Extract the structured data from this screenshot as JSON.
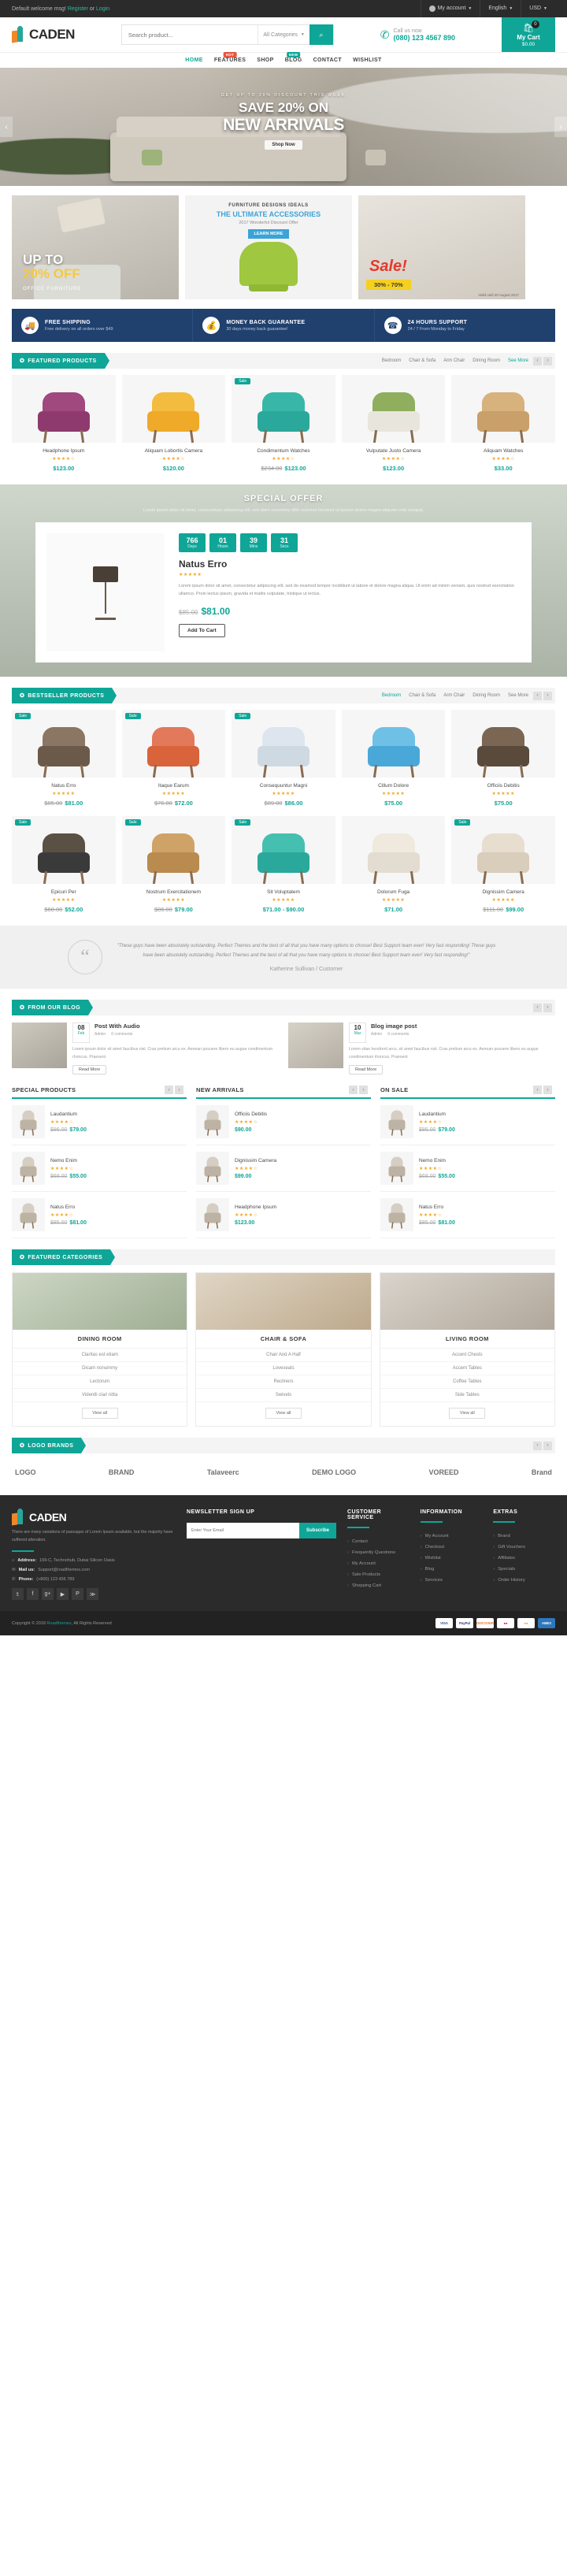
{
  "topbar": {
    "welcome": "Default welcome msg!",
    "register": "Register",
    "or": "or",
    "login": "Login",
    "account": "My account",
    "language": "English",
    "currency": "USD"
  },
  "header": {
    "brand": "CADEN",
    "search_placeholder": "Search product...",
    "category_label": "All Categories",
    "search_icon": "search-icon",
    "call_label": "Call us now",
    "phone": "(080) 123 4567 890",
    "cart_label": "My Cart",
    "cart_total": "$0.00",
    "cart_count": "0"
  },
  "nav": {
    "items": [
      {
        "label": "HOME",
        "active": true,
        "badge": ""
      },
      {
        "label": "FEATURES",
        "active": false,
        "badge": "HOT"
      },
      {
        "label": "SHOP",
        "active": false,
        "badge": ""
      },
      {
        "label": "BLOG",
        "active": false,
        "badge": "NEW"
      },
      {
        "label": "CONTACT",
        "active": false,
        "badge": ""
      },
      {
        "label": "WISHLIST",
        "active": false,
        "badge": ""
      }
    ]
  },
  "hero": {
    "kicker": "GET UP TO 20% DISCOUNT THIS WEEK",
    "line1": "SAVE 20% ON",
    "line2": "NEW ARRIVALS",
    "button": "Shop Now"
  },
  "promos": {
    "left": {
      "l1": "UP TO",
      "l2": "20% OFF",
      "l3": "OFFICE FURNITURE"
    },
    "center": {
      "kicker": "FURNITURE DESIGNS IDEALS",
      "title": "THE ULTIMATE ACCESSORIES",
      "sub": "2017 Wonderful Discount Offer",
      "button": "LEARN MORE"
    },
    "right": {
      "sale": "Sale!",
      "off": "30% - 70%",
      "note": "Valid until 20 August 2017"
    }
  },
  "services": [
    {
      "icon": "truck-icon",
      "title": "FREE SHIPPING",
      "sub": "Free delivery on all orders over $49"
    },
    {
      "icon": "money-icon",
      "title": "MONEY BACK GUARANTEE",
      "sub": "30 days money back guarantee!"
    },
    {
      "icon": "support-icon",
      "title": "24 HOURS SUPPORT",
      "sub": "24 / 7 From Monday to Friday"
    }
  ],
  "featured": {
    "section_title": "FEATURED PRODUCTS",
    "tabs": [
      "Bedroom",
      "Chair & Sofa",
      "Arm Chair",
      "Dining Room",
      "See More"
    ],
    "active_tab": "See More",
    "products": [
      {
        "name": "Headphone Ipsum",
        "price": "$123.00",
        "old": "",
        "stars": 4,
        "sale": false,
        "color": "#8e3a6e",
        "back": "#a0497e"
      },
      {
        "name": "Aliquam Lobortis Camera",
        "price": "$120.00",
        "old": "",
        "stars": 4,
        "sale": false,
        "color": "#efaa2a",
        "back": "#f3bc3e"
      },
      {
        "name": "Condimentum Watches",
        "price": "$123.00",
        "old": "$234.00",
        "stars": 4,
        "sale": true,
        "color": "#2aa89b",
        "back": "#38b7a8"
      },
      {
        "name": "Vulputate Justo Camera",
        "price": "$123.00",
        "old": "",
        "stars": 4,
        "sale": false,
        "color": "#e8e6dc",
        "back": "#8fae5e"
      },
      {
        "name": "Aliquam Watches",
        "price": "$33.00",
        "old": "",
        "stars": 4,
        "sale": false,
        "color": "#c9a06a",
        "back": "#d7b27d"
      }
    ]
  },
  "special": {
    "title": "SPECIAL OFFER",
    "subtitle": "Lorem ipsum dolor sit amet, consectetuer adipiscing elit, sed diam nonummy nibh euismod tincidunt ut laoreet dolore magna aliquam erat volutpat.",
    "countdown": [
      {
        "value": "766",
        "label": "Days"
      },
      {
        "value": "01",
        "label": "Hours"
      },
      {
        "value": "39",
        "label": "Mins"
      },
      {
        "value": "31",
        "label": "Secs"
      }
    ],
    "product_name": "Natus Erro",
    "stars": 5,
    "description": "Lorem ipsum dolor sit amet, consectetur adipiscing elit, sed do eiusmod tempor incididunt ut labore et dolore magna aliqua. Ut enim ad minim veniam, quis nostrud exercitation ullamco. Proin lectus ipsum, gravida et mattis vulputate, tristique ut lectus.",
    "price": "$81.00",
    "old_price": "$85.00",
    "button": "Add To Cart"
  },
  "bestseller": {
    "section_title": "BESTSELLER PRODUCTS",
    "tabs": [
      "Bedroom",
      "Chair & Sofa",
      "Arm Chair",
      "Dining Room",
      "See More"
    ],
    "active_tab": "Bedroom",
    "row1": [
      {
        "name": "Natus Erro",
        "price": "$81.00",
        "old": "$85.00",
        "stars": 5,
        "sale": true
      },
      {
        "name": "Itaque Earum",
        "price": "$72.00",
        "old": "$76.00",
        "stars": 5,
        "sale": true
      },
      {
        "name": "Consequuntur Magni",
        "price": "$86.00",
        "old": "$89.00",
        "stars": 5,
        "sale": true
      },
      {
        "name": "Cillum Dolore",
        "price": "$75.00",
        "old": "",
        "stars": 5,
        "sale": false
      },
      {
        "name": "Officiis Debitis",
        "price": "$75.00",
        "old": "",
        "stars": 5,
        "sale": false
      }
    ],
    "row2": [
      {
        "name": "Epicuri Per",
        "price": "$52.00",
        "old": "$68.00",
        "stars": 5,
        "sale": true
      },
      {
        "name": "Nostrum Exercitationem",
        "price": "$79.00",
        "old": "$86.00",
        "stars": 5,
        "sale": true
      },
      {
        "name": "Sit Voluptatem",
        "price": "$71.00 - $90.00",
        "old": "",
        "stars": 5,
        "sale": true
      },
      {
        "name": "Dolorum Fuga",
        "price": "$71.00",
        "old": "",
        "stars": 5,
        "sale": false
      },
      {
        "name": "Dignissim Camera",
        "price": "$99.00",
        "old": "$111.00",
        "stars": 5,
        "sale": true
      }
    ]
  },
  "testimonial": {
    "text": "\"These guys have been absolutely outstanding. Perfect Themes and the best of all that you have many options to choose! Best Support team ever! Very fast responding! These guys have been absolutely outstanding. Perfect Themes and the best of all that you have many options to choose! Best Support team ever! Very fast responding!\"",
    "author": "Katherine Sullivan",
    "role": "/ Customer"
  },
  "blog": {
    "section_title": "FROM OUR BLOG",
    "posts": [
      {
        "title": "Post With Audio",
        "day": "08",
        "month": "Feb",
        "meta": [
          "Admin",
          "0 comments"
        ],
        "text": "Lorem ipsum dolor sit amet faucibus nisl. Cras pretium arcu ex. Aenean posuere libero eu augue condimentum rhoncus. Praesent",
        "button": "Read More"
      },
      {
        "title": "Blog image post",
        "day": "10",
        "month": "Mar",
        "meta": [
          "Admin",
          "0 comments"
        ],
        "text": "Lorem vitae hendrerit arcu, sit amet faucibus nisl. Cras pretium arcu ex. Aenean posuere libero eu augue condimentum rhoncus. Praesent",
        "button": "Read More"
      }
    ]
  },
  "triple": [
    {
      "heading": "SPECIAL PRODUCTS",
      "items": [
        {
          "name": "Laudantium",
          "price": "$79.00",
          "old": "$86.00",
          "stars": 4
        },
        {
          "name": "Nemo Enim",
          "price": "$55.00",
          "old": "$68.00",
          "stars": 4
        },
        {
          "name": "Natus Erro",
          "price": "$81.00",
          "old": "$85.00",
          "stars": 4
        }
      ]
    },
    {
      "heading": "NEW ARRIVALS",
      "items": [
        {
          "name": "Officiis Debitis",
          "price": "$90.00",
          "old": "",
          "stars": 4
        },
        {
          "name": "Dignissim Camera",
          "price": "$99.00",
          "old": "",
          "stars": 4
        },
        {
          "name": "Headphone Ipsum",
          "price": "$123.00",
          "old": "",
          "stars": 4
        }
      ]
    },
    {
      "heading": "ON SALE",
      "items": [
        {
          "name": "Laudantium",
          "price": "$79.00",
          "old": "$86.00",
          "stars": 4
        },
        {
          "name": "Nemo Enim",
          "price": "$55.00",
          "old": "$68.00",
          "stars": 4
        },
        {
          "name": "Natus Erro",
          "price": "$81.00",
          "old": "$85.00",
          "stars": 4
        }
      ]
    }
  ],
  "categories": {
    "section_title": "FEATURED CATEGORIES",
    "cols": [
      {
        "title": "DINING ROOM",
        "items": [
          "Claritas est etiam",
          "Dicam nonummy",
          "Lectorum",
          "Videntli clari nitta"
        ],
        "button": "View all"
      },
      {
        "title": "CHAIR & SOFA",
        "items": [
          "Chair And A Half",
          "Loveseats",
          "Recliners",
          "Swivels"
        ],
        "button": "View all"
      },
      {
        "title": "LIVING ROOM",
        "items": [
          "Accent Chests",
          "Accent Tables",
          "Coffee Tables",
          "Side Tables"
        ],
        "button": "View all"
      }
    ]
  },
  "brands": {
    "section_title": "LOGO BRANDS",
    "items": [
      "LOGO",
      "BRAND",
      "Talaveerc",
      "DEMO LOGO",
      "VOREED",
      "Brand"
    ]
  },
  "footer": {
    "brand": "CADEN",
    "description": "There are many variations of passages of Lorem Ipsum available, but the majority have suffered alteration.",
    "address_label": "Address:",
    "address": "169-C, Technohub, Dubai Silicon Oasis",
    "mail_label": "Mail us:",
    "mail": "Support@roadthemes.com",
    "phone_label": "Phone:",
    "phone": "(+800) 123 456 789",
    "socials": [
      "twitter-icon",
      "facebook-icon",
      "google-plus-icon",
      "youtube-icon",
      "pinterest-icon",
      "rss-icon"
    ],
    "newsletter": {
      "title": "NEWSLETTER SIGN UP",
      "placeholder": "Enter Your Email",
      "button": "Subscribe"
    },
    "columns": [
      {
        "title": "CUSTOMER SERVICE",
        "links": [
          "Contact",
          "Frequently Questions",
          "My Account",
          "Sale Products",
          "Shopping Cart"
        ]
      },
      {
        "title": "INFORMATION",
        "links": [
          "My Account",
          "Checkout",
          "Wishlist",
          "Blog",
          "Services"
        ]
      },
      {
        "title": "EXTRAS",
        "links": [
          "Brand",
          "Gift Vouchers",
          "Affiliates",
          "Specials",
          "Order History"
        ]
      }
    ],
    "copyright_pre": "Copyright © 2018",
    "copyright_brand": "Roadthemes",
    "copyright_post": ", All Rights Reserved",
    "payments": [
      "VISA",
      "PayPal",
      "DISCOVER",
      "MC",
      "MC2",
      "AMEX"
    ]
  }
}
